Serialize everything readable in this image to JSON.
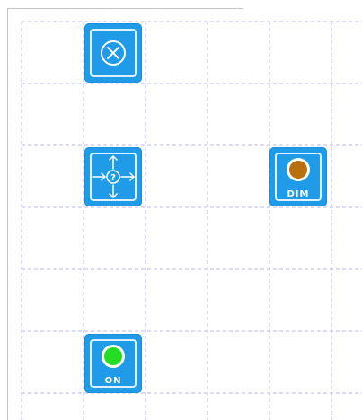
{
  "canvas": {
    "grid_color": "#b8b8f0",
    "tile_color": "#1f9be8"
  },
  "tiles": {
    "close": {
      "icon": "close-circle-icon"
    },
    "move": {
      "icon": "move-help-icon"
    },
    "dim": {
      "label": "DIM",
      "icon": "lamp-dim-icon",
      "lamp_color": "#b8700f"
    },
    "on": {
      "label": "ON",
      "icon": "lamp-on-icon",
      "lamp_color": "#22dd22"
    }
  }
}
